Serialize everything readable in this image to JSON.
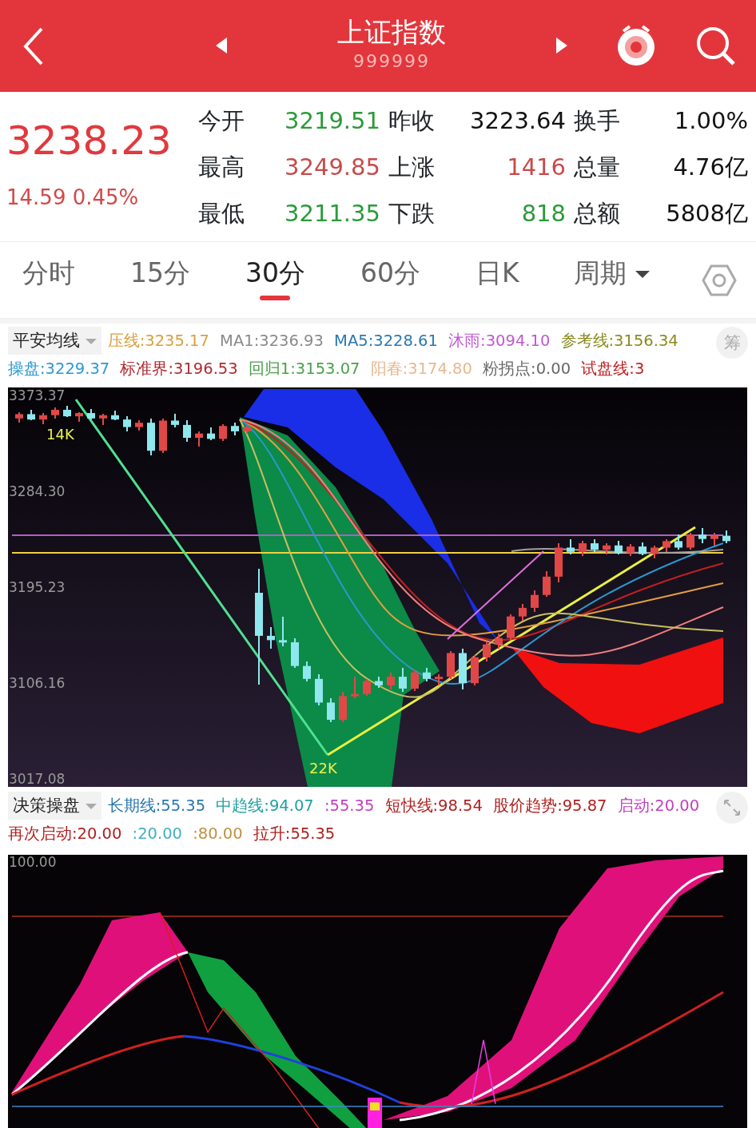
{
  "header": {
    "title": "上证指数",
    "code": "999999"
  },
  "quote": {
    "price": "3238.23",
    "change": "14.59 0.45%",
    "rows": [
      [
        {
          "label": "今开",
          "value": "3219.51",
          "color": "#2a9a3a"
        },
        {
          "label": "昨收",
          "value": "3223.64",
          "color": "#111111"
        },
        {
          "label": "换手",
          "value": "1.00%",
          "color": "#111111"
        }
      ],
      [
        {
          "label": "最高",
          "value": "3249.85",
          "color": "#c84a4a"
        },
        {
          "label": "上涨",
          "value": "1416",
          "color": "#c84a4a"
        },
        {
          "label": "总量",
          "value": "4.76亿",
          "color": "#111111"
        }
      ],
      [
        {
          "label": "最低",
          "value": "3211.35",
          "color": "#2a9a3a"
        },
        {
          "label": "下跌",
          "value": "818",
          "color": "#2a9a3a"
        },
        {
          "label": "总额",
          "value": "5808亿",
          "color": "#111111"
        }
      ]
    ]
  },
  "periods": [
    {
      "label": "分时",
      "selected": false,
      "dropdown": false
    },
    {
      "label": "15分",
      "selected": false,
      "dropdown": false
    },
    {
      "label": "30分",
      "selected": true,
      "dropdown": false
    },
    {
      "label": "60分",
      "selected": false,
      "dropdown": false
    },
    {
      "label": "日K",
      "selected": false,
      "dropdown": false
    },
    {
      "label": "周期",
      "selected": false,
      "dropdown": true
    }
  ],
  "main_indicator": {
    "name": "平安均线",
    "button": "筹",
    "items": [
      {
        "label": "压线:",
        "value": "3235.17",
        "color": "#d8a040"
      },
      {
        "label": "MA1:",
        "value": "3236.93",
        "color": "#8a8a8a"
      },
      {
        "label": "MA5:",
        "value": "3228.61",
        "color": "#2a78b0"
      },
      {
        "label": "沐雨:",
        "value": "3094.10",
        "color": "#c058d0"
      },
      {
        "label": "参考线:",
        "value": "3156.34",
        "color": "#8a8a20"
      },
      {
        "label": "操盘:",
        "value": "3229.37",
        "color": "#2a98d0"
      },
      {
        "label": "标准界:",
        "value": "3196.53",
        "color": "#b02a30"
      },
      {
        "label": "回归1:",
        "value": "3153.07",
        "color": "#4aa04a"
      },
      {
        "label": "阳春:",
        "value": "3174.80",
        "color": "#e8b890"
      },
      {
        "label": "粉拐点:",
        "value": "0.00",
        "color": "#666666"
      },
      {
        "label": "试盘线:",
        "value": "3",
        "color": "#c02020"
      }
    ]
  },
  "main_chart": {
    "chart_data": {
      "type": "candlestick",
      "ylim": [
        3017.08,
        3373.37
      ],
      "categories": [
        null,
        null,
        null,
        null,
        null,
        null,
        null,
        null,
        null,
        null,
        null,
        null,
        null,
        null,
        null,
        null,
        null,
        null,
        null,
        null,
        null,
        null,
        null,
        null,
        null,
        null,
        null,
        null,
        null,
        null,
        null,
        null,
        null,
        null,
        null,
        null,
        null,
        null,
        null,
        null,
        null,
        null,
        null,
        null,
        null,
        null,
        null,
        null,
        null,
        null,
        null,
        null,
        null,
        null,
        null,
        null,
        null,
        null,
        null,
        null
      ],
      "yticks": [
        {
          "value": 3373.37,
          "label": "3373.37"
        },
        {
          "value": 3284.3,
          "label": "3284.30"
        },
        {
          "value": 3195.23,
          "label": "3195.23"
        },
        {
          "value": 3106.16,
          "label": "3106.16"
        },
        {
          "value": 3017.08,
          "label": "3017.08"
        }
      ],
      "ohlc": [
        [
          3352,
          3358,
          3348,
          3356
        ],
        [
          3356,
          3360,
          3350,
          3351
        ],
        [
          3351,
          3357,
          3347,
          3355
        ],
        [
          3355,
          3362,
          3352,
          3360
        ],
        [
          3360,
          3364,
          3353,
          3354
        ],
        [
          3354,
          3358,
          3349,
          3357
        ],
        [
          3357,
          3361,
          3351,
          3352
        ],
        [
          3352,
          3356,
          3346,
          3355
        ],
        [
          3355,
          3359,
          3350,
          3351
        ],
        [
          3351,
          3354,
          3340,
          3344
        ],
        [
          3344,
          3350,
          3341,
          3348
        ],
        [
          3348,
          3352,
          3318,
          3322
        ],
        [
          3322,
          3352,
          3320,
          3350
        ],
        [
          3350,
          3356,
          3344,
          3346
        ],
        [
          3346,
          3350,
          3330,
          3334
        ],
        [
          3334,
          3340,
          3326,
          3338
        ],
        [
          3338,
          3344,
          3332,
          3333
        ],
        [
          3333,
          3347,
          3331,
          3345
        ],
        [
          3345,
          3348,
          3336,
          3340
        ],
        [
          3340,
          3346,
          3338,
          3344
        ],
        [
          3190,
          3212,
          3105,
          3150
        ],
        [
          3150,
          3158,
          3138,
          3146
        ],
        [
          3146,
          3168,
          3140,
          3144
        ],
        [
          3144,
          3148,
          3120,
          3122
        ],
        [
          3122,
          3126,
          3108,
          3110
        ],
        [
          3110,
          3114,
          3085,
          3088
        ],
        [
          3088,
          3092,
          3070,
          3072
        ],
        [
          3072,
          3098,
          3070,
          3094
        ],
        [
          3094,
          3112,
          3092,
          3096
        ],
        [
          3096,
          3110,
          3094,
          3108
        ],
        [
          3108,
          3112,
          3102,
          3104
        ],
        [
          3104,
          3116,
          3100,
          3112
        ],
        [
          3112,
          3120,
          3098,
          3101
        ],
        [
          3101,
          3118,
          3099,
          3116
        ],
        [
          3116,
          3120,
          3108,
          3110
        ],
        [
          3110,
          3114,
          3104,
          3112
        ],
        [
          3112,
          3136,
          3110,
          3134
        ],
        [
          3134,
          3138,
          3100,
          3106
        ],
        [
          3106,
          3132,
          3104,
          3130
        ],
        [
          3130,
          3145,
          3126,
          3142
        ],
        [
          3142,
          3152,
          3138,
          3148
        ],
        [
          3148,
          3170,
          3146,
          3168
        ],
        [
          3168,
          3180,
          3164,
          3176
        ],
        [
          3176,
          3192,
          3172,
          3188
        ],
        [
          3188,
          3210,
          3186,
          3205
        ],
        [
          3205,
          3236,
          3200,
          3232
        ],
        [
          3232,
          3240,
          3226,
          3228
        ],
        [
          3228,
          3238,
          3224,
          3236
        ],
        [
          3236,
          3240,
          3228,
          3230
        ],
        [
          3230,
          3236,
          3226,
          3234
        ],
        [
          3234,
          3238,
          3226,
          3227
        ],
        [
          3227,
          3235,
          3224,
          3233
        ],
        [
          3233,
          3237,
          3225,
          3226
        ],
        [
          3226,
          3234,
          3222,
          3232
        ],
        [
          3232,
          3240,
          3228,
          3238
        ],
        [
          3238,
          3244,
          3230,
          3232
        ],
        [
          3232,
          3246,
          3230,
          3244
        ],
        [
          3244,
          3250,
          3236,
          3240
        ],
        [
          3240,
          3246,
          3234,
          3243
        ],
        [
          3243,
          3248,
          3236,
          3238
        ]
      ],
      "annotations": [
        "14K",
        "22K"
      ]
    }
  },
  "sub_indicator": {
    "name": "决策操盘",
    "items": [
      {
        "label": "长期线:",
        "value": "55.35",
        "color": "#2a78b0"
      },
      {
        "label": "中趋线:",
        "value": "94.07",
        "color": "#20a0a0"
      },
      {
        "label": ":",
        "value": "55.35",
        "color": "#c040c0"
      },
      {
        "label": "短快线:",
        "value": "98.54",
        "color": "#b02020"
      },
      {
        "label": "股价趋势:",
        "value": "95.87",
        "color": "#b02020"
      },
      {
        "label": "启动:",
        "value": "20.00",
        "color": "#c040c0"
      },
      {
        "label": "再次启动:",
        "value": "20.00",
        "color": "#b02020"
      },
      {
        "label": ":",
        "value": "20.00",
        "color": "#40b0c0"
      },
      {
        "label": ":",
        "value": "80.00",
        "color": "#c09040"
      },
      {
        "label": "拉升:",
        "value": "55.35",
        "color": "#b02020"
      }
    ]
  },
  "sub_chart": {
    "axis_label": "100.00"
  }
}
